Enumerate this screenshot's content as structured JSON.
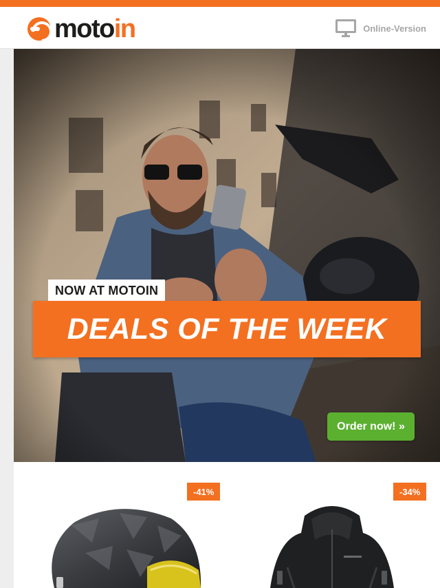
{
  "header": {
    "logo": {
      "text_dark": "moto",
      "text_orange": "in"
    },
    "online_version": {
      "icon": "monitor-icon",
      "label": "Online-Version"
    }
  },
  "hero": {
    "tag": "NOW AT MOTOIN",
    "headline": "DEALS OF THE WEEK",
    "cta_label": "Order now! »"
  },
  "products": [
    {
      "discount": "-41%",
      "image": "carbon-motorcycle-helmet"
    },
    {
      "discount": "-34%",
      "image": "black-softshell-hooded-jacket"
    }
  ],
  "colors": {
    "accent": "#f37021",
    "cta": "#5bb030",
    "muted": "#a6a6a6",
    "text": "#1d1d1b"
  }
}
